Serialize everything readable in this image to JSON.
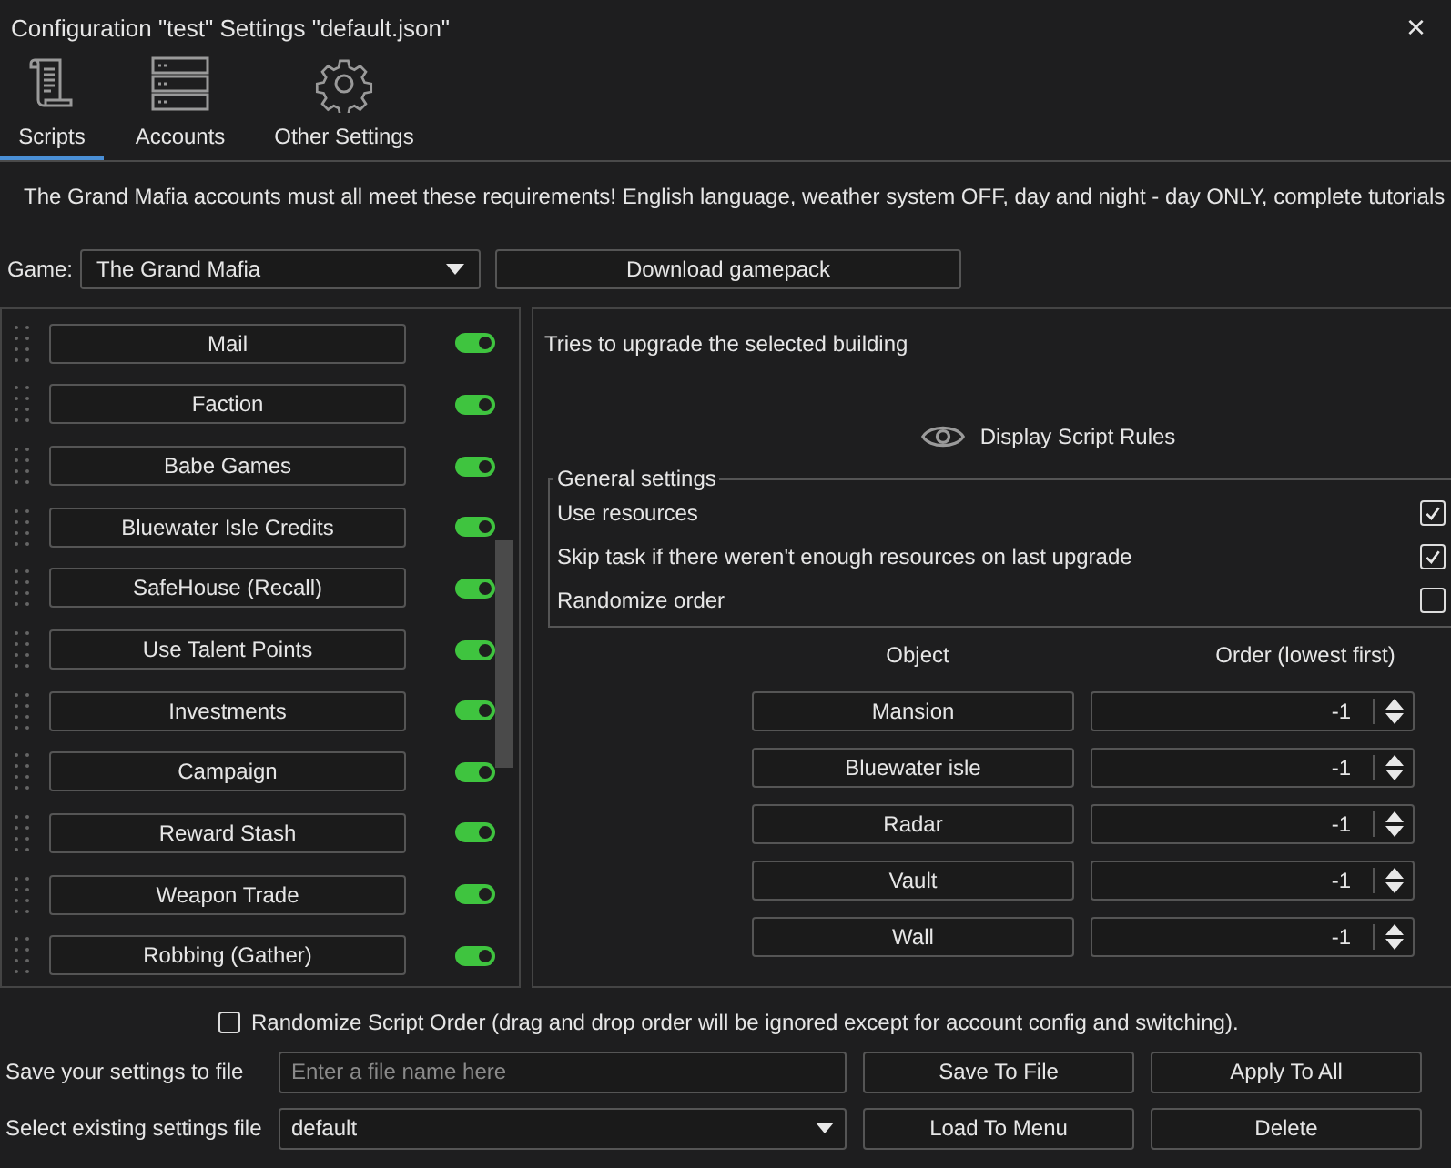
{
  "window": {
    "title": "Configuration \"test\" Settings \"default.json\"",
    "close": "×"
  },
  "tabs": [
    {
      "label": "Scripts",
      "kind": "scroll",
      "selected": true
    },
    {
      "label": "Accounts",
      "kind": "server",
      "selected": false
    },
    {
      "label": "Other Settings",
      "kind": "gear",
      "selected": false
    }
  ],
  "notice": "The Grand Mafia accounts must all meet these requirements! English language, weather system OFF, day and night - day ONLY, complete tutorials",
  "game": {
    "label": "Game:",
    "value": "The Grand Mafia",
    "download_button": "Download gamepack"
  },
  "scripts": [
    {
      "name": "Mail",
      "on": true
    },
    {
      "name": "Faction",
      "on": true
    },
    {
      "name": "Babe Games",
      "on": true
    },
    {
      "name": "Bluewater Isle Credits",
      "on": true
    },
    {
      "name": "SafeHouse (Recall)",
      "on": true
    },
    {
      "name": "Use Talent Points",
      "on": true
    },
    {
      "name": "Investments",
      "on": true
    },
    {
      "name": "Campaign",
      "on": true
    },
    {
      "name": "Reward Stash",
      "on": true
    },
    {
      "name": "Weapon Trade",
      "on": true
    },
    {
      "name": "Robbing (Gather)",
      "on": true
    }
  ],
  "details": {
    "description": "Tries to upgrade the selected building",
    "rules_button": "Display Script Rules",
    "general_settings": {
      "title": "General settings",
      "options": [
        {
          "label": "Use resources",
          "checked": true
        },
        {
          "label": "Skip task if there weren't enough resources on last upgrade",
          "checked": true
        },
        {
          "label": "Randomize order",
          "checked": false
        }
      ]
    },
    "table": {
      "columns": [
        "Object",
        "Order (lowest first)"
      ],
      "rows": [
        {
          "object": "Mansion",
          "order": "-1"
        },
        {
          "object": "Bluewater isle",
          "order": "-1"
        },
        {
          "object": "Radar",
          "order": "-1"
        },
        {
          "object": "Vault",
          "order": "-1"
        },
        {
          "object": "Wall",
          "order": "-1"
        }
      ]
    }
  },
  "randomize_script_order": {
    "label": "Randomize Script Order (drag and drop order will be ignored except for account config and switching).",
    "checked": false
  },
  "save": {
    "label": "Save your settings to file",
    "placeholder": "Enter a file name here",
    "save_button": "Save To File",
    "apply_button": "Apply To All"
  },
  "load": {
    "label": "Select existing settings file",
    "value": "default",
    "load_button": "Load To Menu",
    "delete_button": "Delete"
  }
}
